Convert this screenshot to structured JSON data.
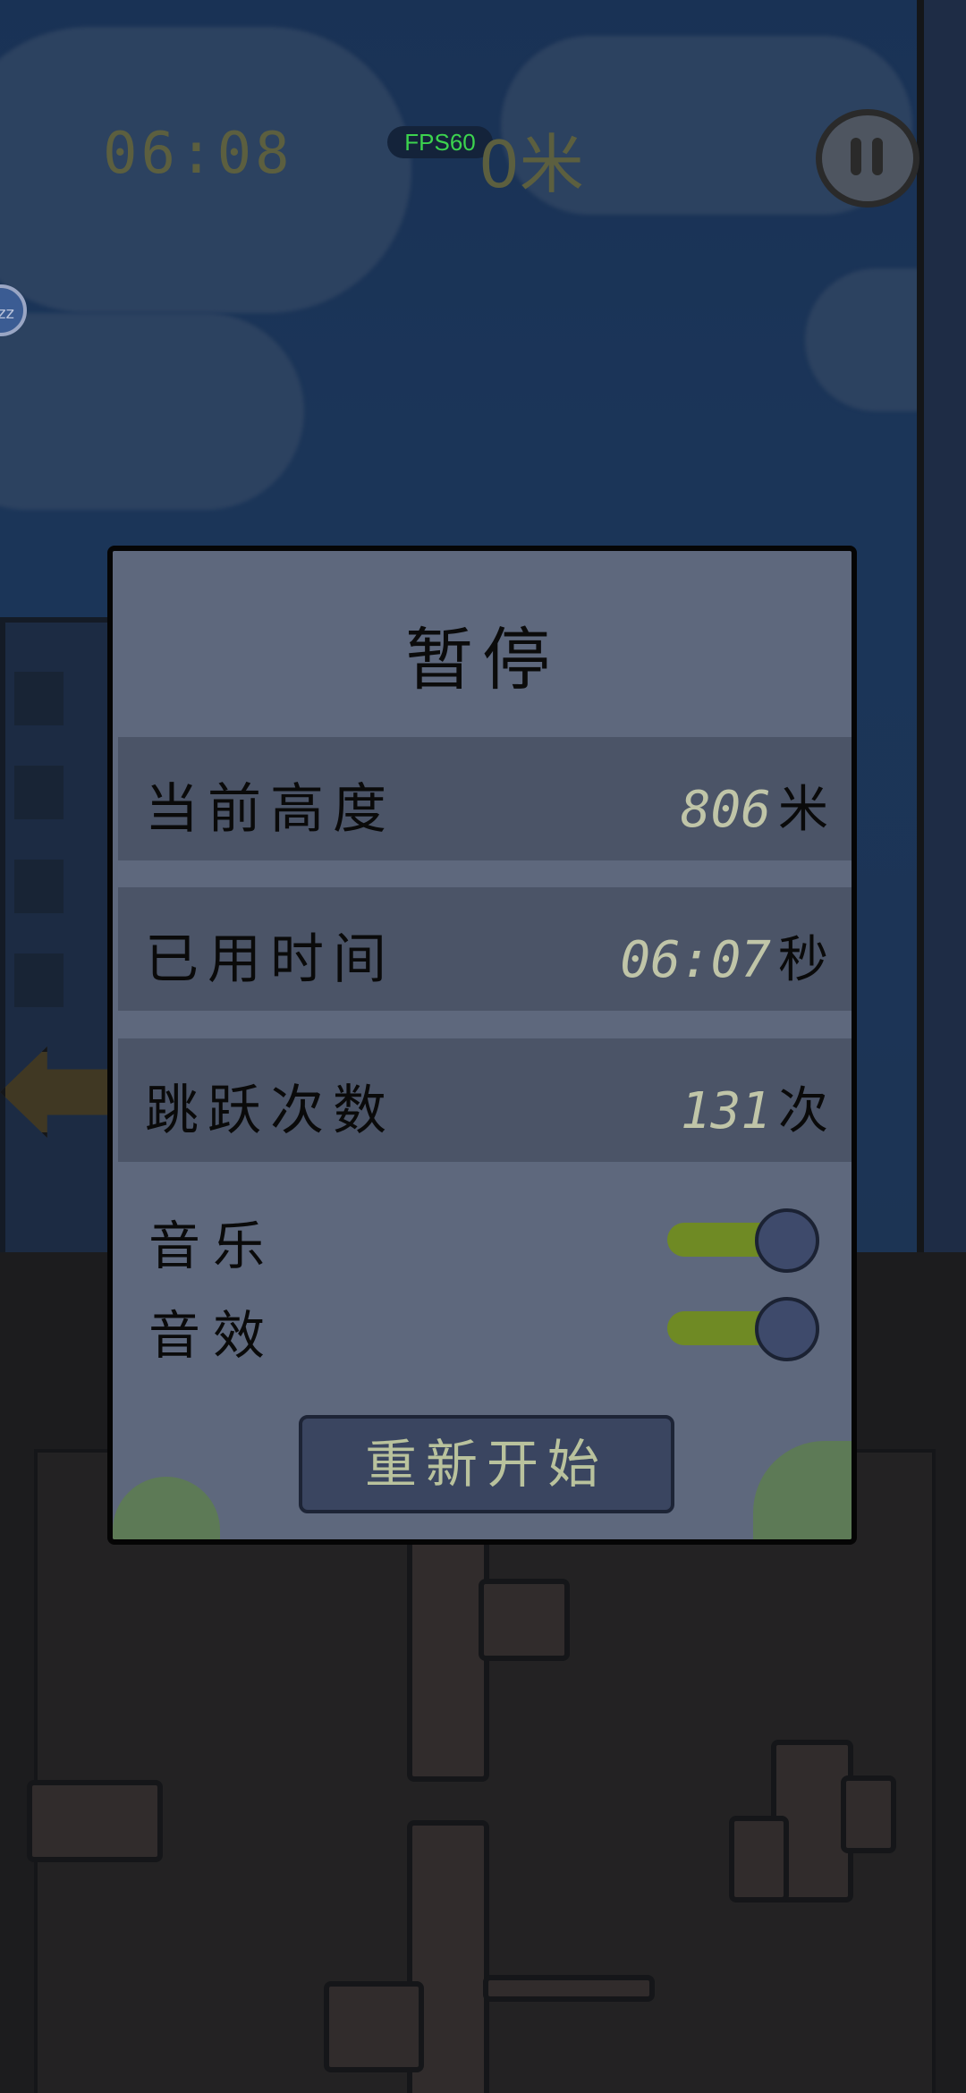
{
  "hud": {
    "time": "06:08",
    "height": "0米",
    "fps": "FPS60",
    "side_bubble": "zz"
  },
  "dialog": {
    "title": "暂停",
    "stats": [
      {
        "label": "当前高度",
        "value": "806",
        "unit": "米"
      },
      {
        "label": "已用时间",
        "value": "06:07",
        "unit": "秒"
      },
      {
        "label": "跳跃次数",
        "value": "131",
        "unit": "次"
      }
    ],
    "toggles": [
      {
        "label": "音乐",
        "on": true
      },
      {
        "label": "音效",
        "on": true
      }
    ],
    "restart_label": "重新开始"
  },
  "colors": {
    "toggle_on": "#6f8a24",
    "fps_text": "#3cd34e",
    "dialog_bg": "#5e687d"
  }
}
